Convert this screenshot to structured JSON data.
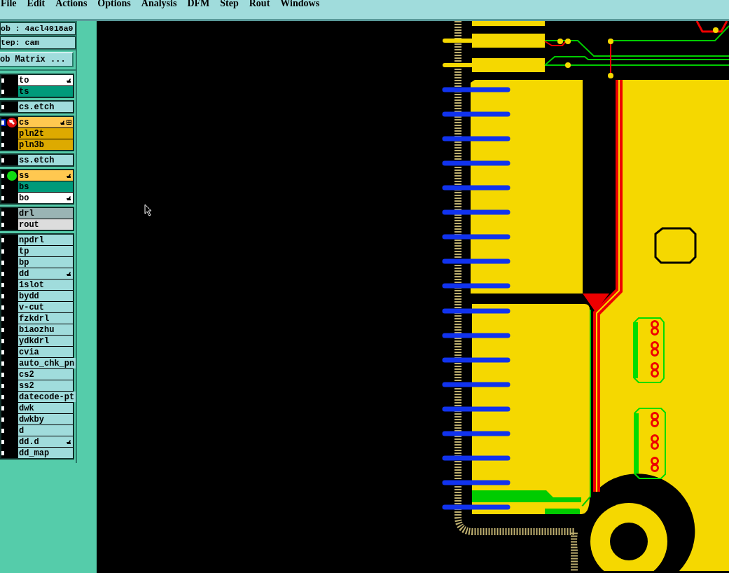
{
  "menu": [
    "File",
    "Edit",
    "Actions",
    "Options",
    "Analysis",
    "DFM",
    "Step",
    "Rout",
    "Windows"
  ],
  "job_field": "ob : 4acl4018a0",
  "step_field": "tep: cam",
  "job_matrix_button": "ob Matrix ...",
  "layer_groups": [
    {
      "layers": [
        {
          "name": "to",
          "color": "#ffffff",
          "hand": true,
          "grid": false,
          "active": false,
          "arrow_marker": false,
          "dot_marker": false
        },
        {
          "name": "ts",
          "color": "#009a7a",
          "hand": false,
          "grid": false,
          "active": false,
          "arrow_marker": false,
          "dot_marker": false
        }
      ]
    },
    {
      "layers": [
        {
          "name": "cs.etch",
          "color": "#a0dcdc",
          "hand": false,
          "grid": false,
          "active": false,
          "arrow_marker": false,
          "dot_marker": false
        }
      ]
    },
    {
      "layers": [
        {
          "name": "cs",
          "color": "#ffc850",
          "hand": true,
          "grid": true,
          "active": true,
          "arrow_marker": true,
          "dot_marker": false
        },
        {
          "name": "pln2t",
          "color": "#ddaa00",
          "hand": false,
          "grid": false,
          "active": false,
          "arrow_marker": false,
          "dot_marker": false
        },
        {
          "name": "pln3b",
          "color": "#ddaa00",
          "hand": false,
          "grid": false,
          "active": false,
          "arrow_marker": false,
          "dot_marker": false
        }
      ]
    },
    {
      "layers": [
        {
          "name": "ss.etch",
          "color": "#a0dcdc",
          "hand": false,
          "grid": false,
          "active": false,
          "arrow_marker": false,
          "dot_marker": false
        }
      ]
    },
    {
      "layers": [
        {
          "name": "ss",
          "color": "#ffc850",
          "hand": true,
          "grid": false,
          "active": false,
          "arrow_marker": false,
          "dot_marker": true
        },
        {
          "name": "bs",
          "color": "#009a7a",
          "hand": false,
          "grid": false,
          "active": false,
          "arrow_marker": false,
          "dot_marker": false
        },
        {
          "name": "bo",
          "color": "#ffffff",
          "hand": true,
          "grid": false,
          "active": false,
          "arrow_marker": false,
          "dot_marker": false
        }
      ]
    },
    {
      "layers": [
        {
          "name": "drl",
          "color": "#9ab4b4",
          "hand": false,
          "grid": false,
          "active": false,
          "arrow_marker": false,
          "dot_marker": false
        },
        {
          "name": "rout",
          "color": "#dcdcdc",
          "hand": false,
          "grid": false,
          "active": false,
          "arrow_marker": false,
          "dot_marker": false
        }
      ]
    },
    {
      "layers": [
        {
          "name": "npdrl",
          "color": "#a0dcdc",
          "hand": false,
          "grid": false,
          "active": false,
          "arrow_marker": false,
          "dot_marker": false
        },
        {
          "name": "tp",
          "color": "#a0dcdc",
          "hand": false,
          "grid": false,
          "active": false,
          "arrow_marker": false,
          "dot_marker": false
        },
        {
          "name": "bp",
          "color": "#a0dcdc",
          "hand": false,
          "grid": false,
          "active": false,
          "arrow_marker": false,
          "dot_marker": false
        },
        {
          "name": "dd",
          "color": "#a0dcdc",
          "hand": true,
          "grid": false,
          "active": false,
          "arrow_marker": false,
          "dot_marker": false
        },
        {
          "name": "1slot",
          "color": "#a0dcdc",
          "hand": false,
          "grid": false,
          "active": false,
          "arrow_marker": false,
          "dot_marker": false
        },
        {
          "name": "bydd",
          "color": "#a0dcdc",
          "hand": false,
          "grid": false,
          "active": false,
          "arrow_marker": false,
          "dot_marker": false
        },
        {
          "name": "v-cut",
          "color": "#a0dcdc",
          "hand": false,
          "grid": false,
          "active": false,
          "arrow_marker": false,
          "dot_marker": false
        },
        {
          "name": "fzkdrl",
          "color": "#a0dcdc",
          "hand": false,
          "grid": false,
          "active": false,
          "arrow_marker": false,
          "dot_marker": false
        },
        {
          "name": "biaozhu",
          "color": "#a0dcdc",
          "hand": false,
          "grid": false,
          "active": false,
          "arrow_marker": false,
          "dot_marker": false
        },
        {
          "name": "ydkdrl",
          "color": "#a0dcdc",
          "hand": false,
          "grid": false,
          "active": false,
          "arrow_marker": false,
          "dot_marker": false
        },
        {
          "name": "cvia",
          "color": "#a0dcdc",
          "hand": false,
          "grid": false,
          "active": false,
          "arrow_marker": false,
          "dot_marker": false
        },
        {
          "name": "auto_chk_pn",
          "color": "#a0dcdc",
          "hand": false,
          "grid": false,
          "active": false,
          "arrow_marker": false,
          "dot_marker": false
        },
        {
          "name": "cs2",
          "color": "#a0dcdc",
          "hand": false,
          "grid": false,
          "active": false,
          "arrow_marker": false,
          "dot_marker": false
        },
        {
          "name": "ss2",
          "color": "#a0dcdc",
          "hand": false,
          "grid": false,
          "active": false,
          "arrow_marker": false,
          "dot_marker": false
        },
        {
          "name": "datecode-pt",
          "color": "#a0dcdc",
          "hand": false,
          "grid": false,
          "active": false,
          "arrow_marker": false,
          "dot_marker": false
        },
        {
          "name": "dwk",
          "color": "#a0dcdc",
          "hand": false,
          "grid": false,
          "active": false,
          "arrow_marker": false,
          "dot_marker": false
        },
        {
          "name": "dwkby",
          "color": "#a0dcdc",
          "hand": false,
          "grid": false,
          "active": false,
          "arrow_marker": false,
          "dot_marker": false
        },
        {
          "name": "d",
          "color": "#a0dcdc",
          "hand": false,
          "grid": false,
          "active": false,
          "arrow_marker": false,
          "dot_marker": false
        },
        {
          "name": "dd.d",
          "color": "#a0dcdc",
          "hand": true,
          "grid": false,
          "active": false,
          "arrow_marker": false,
          "dot_marker": false
        },
        {
          "name": "dd_map",
          "color": "#a0dcdc",
          "hand": false,
          "grid": false,
          "active": false,
          "arrow_marker": false,
          "dot_marker": false
        }
      ]
    }
  ]
}
